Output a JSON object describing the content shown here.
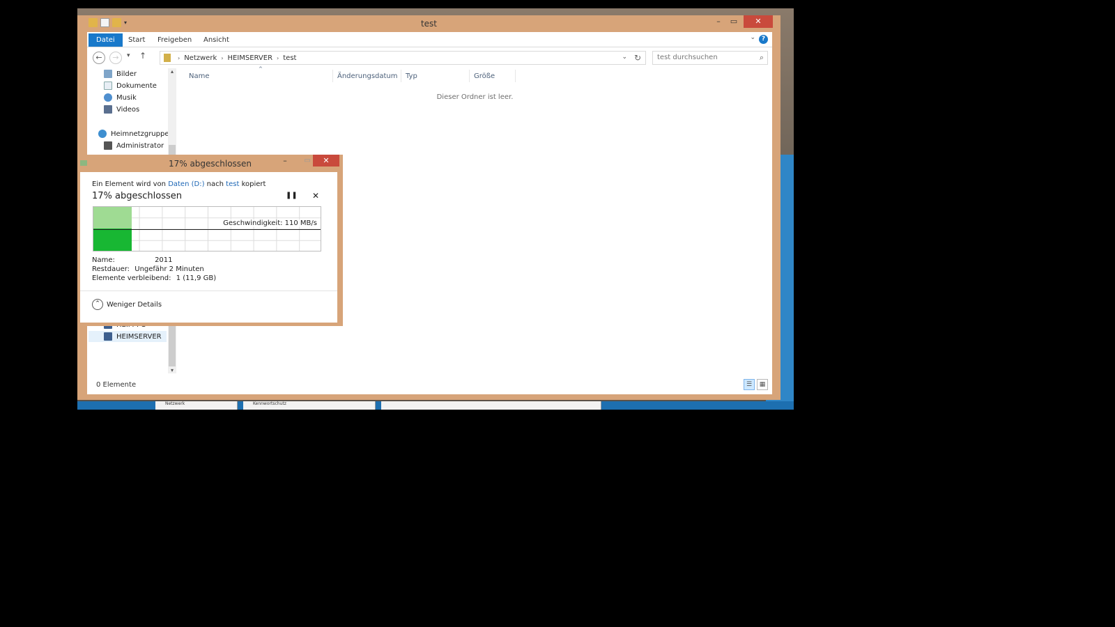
{
  "explorer": {
    "title": "test",
    "ribbon_tabs": [
      "Datei",
      "Start",
      "Freigeben",
      "Ansicht"
    ],
    "help_label": "?",
    "address_path": [
      "Netzwerk",
      "HEIMSERVER",
      "test"
    ],
    "search_placeholder": "test durchsuchen",
    "nav_items": {
      "bilder": "Bilder",
      "dokumente": "Dokumente",
      "musik": "Musik",
      "videos": "Videos",
      "heimnetzgruppe": "Heimnetzgruppe",
      "administrator": "Administrator",
      "heim_pc": "HEIM-PC",
      "heimserver": "HEIMSERVER"
    },
    "columns": [
      "Name",
      "Änderungsdatum",
      "Typ",
      "Größe"
    ],
    "empty_message": "Dieser Ordner ist leer.",
    "status_count": "0 Elemente"
  },
  "dialog": {
    "title": "17% abgeschlossen",
    "line_prefix": "Ein Element wird von",
    "source_link": "Daten (D:)",
    "line_middle": "nach",
    "dest_link": "test",
    "line_suffix": "kopiert",
    "progress_heading": "17% abgeschlossen",
    "progress_fraction": 0.17,
    "speed_text": "Geschwindigkeit: 110 MB/s",
    "name_label": "Name:",
    "name_value": "2011",
    "remaining_time_label": "Restdauer:",
    "remaining_time_value": "Ungefähr 2 Minuten",
    "items_remaining_label": "Elemente verbleibend:",
    "items_remaining_value": "1 (11,9 GB)",
    "less_details": "Weniger Details"
  },
  "taskbar": {
    "items": [
      "Netzwerk",
      "Kennwortschutz"
    ]
  },
  "colors": {
    "window_frame": "#d7a479",
    "ribbon_file_tab": "#1979ca",
    "progress_dark": "#18b733",
    "progress_light": "#9fdb93",
    "close_button": "#c94a3c",
    "link": "#1c66b5"
  }
}
